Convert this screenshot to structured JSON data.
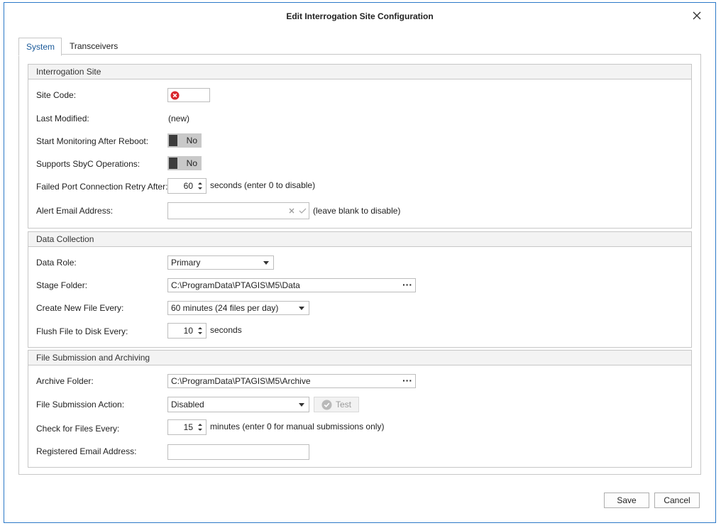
{
  "window": {
    "title": "Edit Interrogation Site Configuration"
  },
  "tabs": [
    {
      "label": "System",
      "active": true
    },
    {
      "label": "Transceivers",
      "active": false
    }
  ],
  "interrogation_site": {
    "header": "Interrogation Site",
    "site_code_label": "Site Code:",
    "site_code_value": "",
    "last_modified_label": "Last Modified:",
    "last_modified_value": "(new)",
    "start_monitoring_label": "Start Monitoring After Reboot:",
    "start_monitoring_value": "No",
    "supports_sbyc_label": "Supports SbyC Operations:",
    "supports_sbyc_value": "No",
    "retry_label": "Failed Port Connection Retry After:",
    "retry_value": "60",
    "retry_suffix": "seconds (enter 0 to disable)",
    "alert_email_label": "Alert Email Address:",
    "alert_email_value": "",
    "alert_email_suffix": "(leave blank to disable)"
  },
  "data_collection": {
    "header": "Data Collection",
    "data_role_label": "Data Role:",
    "data_role_value": "Primary",
    "stage_folder_label": "Stage Folder:",
    "stage_folder_value": "C:\\ProgramData\\PTAGIS\\M5\\Data",
    "new_file_label": "Create New File Every:",
    "new_file_value": "60 minutes (24 files per day)",
    "flush_label": "Flush File to Disk Every:",
    "flush_value": "10",
    "flush_suffix": "seconds"
  },
  "file_submission": {
    "header": "File Submission and Archiving",
    "archive_folder_label": "Archive Folder:",
    "archive_folder_value": "C:\\ProgramData\\PTAGIS\\M5\\Archive",
    "action_label": "File Submission Action:",
    "action_value": "Disabled",
    "test_label": "Test",
    "check_label": "Check for Files Every:",
    "check_value": "15",
    "check_suffix": "minutes (enter 0 for manual submissions only)",
    "registered_email_label": "Registered Email Address:",
    "registered_email_value": ""
  },
  "footer": {
    "save_label": "Save",
    "cancel_label": "Cancel"
  },
  "colors": {
    "accent": "#2b79c8",
    "error": "#d9262d",
    "toggle_off": "#c9c9c9"
  }
}
